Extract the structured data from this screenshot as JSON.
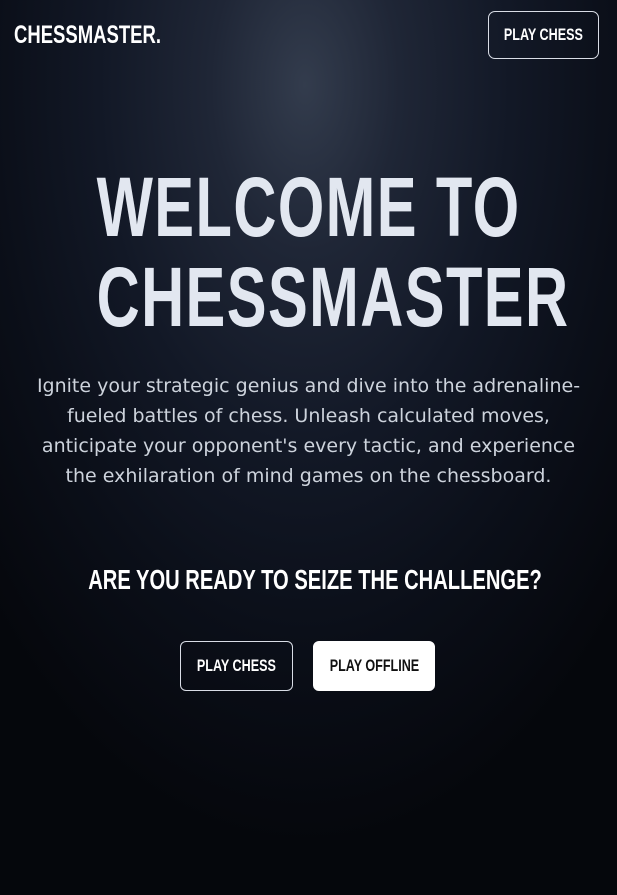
{
  "header": {
    "logo": "CHESSMASTER.",
    "nav_button": "PLAY CHESS"
  },
  "hero": {
    "title_line_1": "WELCOME TO",
    "title_line_2": "CHESSMASTER",
    "description": "Ignite your strategic genius and dive into the adrenaline-fueled battles of chess. Unleash calculated moves, anticipate your opponent's every tactic, and experience the exhilaration of mind games on the chessboard.",
    "challenge": "ARE YOU READY TO SEIZE THE CHALLENGE?",
    "buttons": {
      "play_chess": "PLAY CHESS",
      "play_offline": "PLAY OFFLINE"
    }
  },
  "colors": {
    "background_center": "#333c4d",
    "background_edge": "#05070c",
    "title": "#e2e7f0",
    "body_text": "#cdd3dc",
    "solid_button_bg": "#ffffff"
  }
}
